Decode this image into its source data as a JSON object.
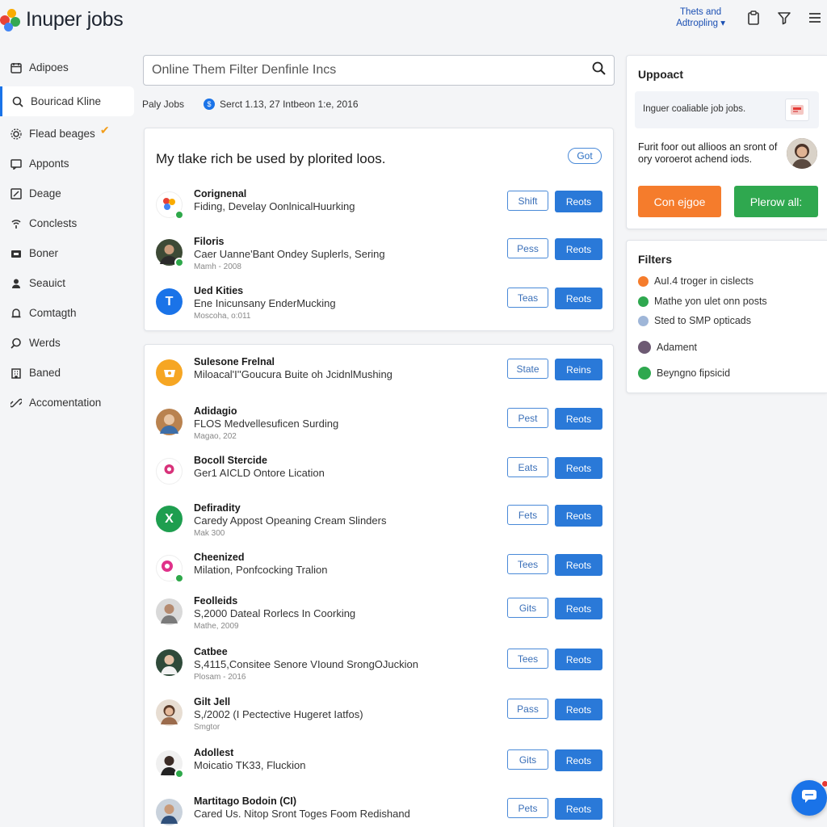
{
  "app": {
    "logo_text": "Inuper jobs"
  },
  "header": {
    "theme_link_line1": "Thets and",
    "theme_link_line2": "Adtropling ▾"
  },
  "sidebar": {
    "items": [
      {
        "label": "Adipoes",
        "icon": "calendar-icon"
      },
      {
        "label": "Bouricad Kline",
        "icon": "search-icon"
      },
      {
        "label": "Flead beages",
        "icon": "settings-icon"
      },
      {
        "label": "Apponts",
        "icon": "message-icon"
      },
      {
        "label": "Deage",
        "icon": "edit-icon"
      },
      {
        "label": "Conclests",
        "icon": "broadcast-icon"
      },
      {
        "label": "Boner",
        "icon": "media-icon"
      },
      {
        "label": "Seauict",
        "icon": "person-icon"
      },
      {
        "label": "Comtagth",
        "icon": "bell-icon"
      },
      {
        "label": "Werds",
        "icon": "search-icon"
      },
      {
        "label": "Baned",
        "icon": "building-icon"
      },
      {
        "label": "Accomentation",
        "icon": "link-icon"
      }
    ]
  },
  "search": {
    "placeholder": "Online Them Filter Denfinle Incs"
  },
  "subbar": {
    "left": "Paly Jobs",
    "dot": "$",
    "right": "Serct 1.13, 27 Intbeon 1:e, 2016"
  },
  "card1": {
    "title": "My tlake rich be used by plorited loos.",
    "got_label": "Got",
    "jobs": [
      {
        "name": "Corignenal",
        "desc": "Fiding, Develay OonlnicalHuurking",
        "meta": "",
        "out": "Shift",
        "fill": "Reots"
      },
      {
        "name": "Filoris",
        "desc": "Caer Uanne'Bant Ondey Suplerls, Sering",
        "meta": "Mamh - 2008",
        "out": "Pess",
        "fill": "Reots"
      },
      {
        "name": "Ued Kities",
        "desc": "Ene Inicunsany EnderMucking",
        "meta": "Moscoha, o:011",
        "out": "Teas",
        "fill": "Reots"
      }
    ]
  },
  "card2": {
    "jobs": [
      {
        "name": "Sulesone Frelnal",
        "desc": "Miloacal'I''Goucura Buite oh JcidnlMushing",
        "meta": "",
        "out": "State",
        "fill": "Reins"
      },
      {
        "name": "Adidagio",
        "desc": "FLOS Medvellesuficen Surding",
        "meta": "Magao, 202",
        "out": "Pest",
        "fill": "Reots"
      },
      {
        "name": "Bocoll Stercide",
        "desc": "Ger1 AICLD Ontore Lication",
        "meta": "",
        "out": "Eats",
        "fill": "Reots"
      },
      {
        "name": "Defiradity",
        "desc": "Caredy Appost Opeaning Cream Slinders",
        "meta": "Mak 300",
        "out": "Fets",
        "fill": "Reots"
      },
      {
        "name": "Cheenized",
        "desc": "Milation, Ponfcocking Tralion",
        "meta": "",
        "out": "Tees",
        "fill": "Reots"
      },
      {
        "name": "Feolleids",
        "desc": "S,2000 Dateal Rorlecs In Coorking",
        "meta": "Mathe, 2009",
        "out": "Gits",
        "fill": "Reots"
      },
      {
        "name": "Catbee",
        "desc": "S,4115,Consitee Senore VIound SrongOJuckion",
        "meta": "Plosam - 2016",
        "out": "Tees",
        "fill": "Reots"
      },
      {
        "name": "Gilt Jell",
        "desc": "S,/2002 (I Pectective Hugeret Iatfos)",
        "meta": "Smgtor",
        "out": "Pass",
        "fill": "Reots"
      },
      {
        "name": "Adollest",
        "desc": "Moicatio TK33, Fluckion",
        "meta": "",
        "out": "Gits",
        "fill": "Reots"
      },
      {
        "name": "Martitago Bodoin (CI)",
        "desc": "Cared Us. Nitop Sront Toges Foom Redishand",
        "meta": "",
        "out": "Pets",
        "fill": "Reots"
      }
    ]
  },
  "promo": {
    "title": "Uppoact",
    "notice": "Inguer coaliable job jobs.",
    "text": "Furit foor out allioos an sront of ory voroerot achend iods.",
    "orange_label": "Con ejgoe",
    "green_label": "Plerow all:"
  },
  "filters": {
    "title": "Filters",
    "items": [
      {
        "label": "AuI.4 troger in cislects",
        "color": "#f57c2c"
      },
      {
        "label": "Mathe yon ulet onn posts",
        "color": "#2fa84f"
      },
      {
        "label": "Sted to SMP opticads",
        "color": "#9fb6d8"
      },
      {
        "label": "Adament",
        "color": "#6d5a73"
      },
      {
        "label": "Beyngno fipsicid",
        "color": "#2fa84f"
      }
    ]
  }
}
